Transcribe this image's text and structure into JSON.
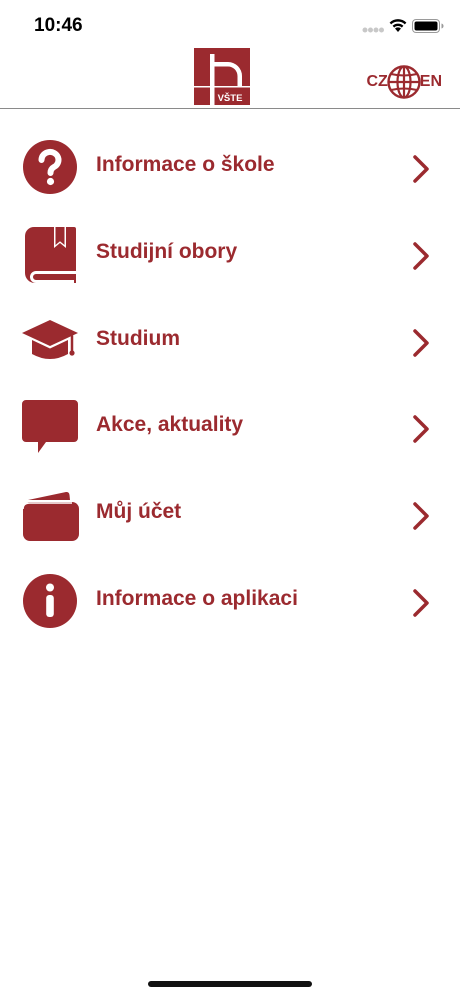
{
  "status_bar": {
    "time": "10:46"
  },
  "header": {
    "logo_text": "VŠTE",
    "lang_left": "CZ",
    "lang_right": "EN"
  },
  "colors": {
    "accent": "#9b2a2f",
    "divider": "#8a8a8a"
  },
  "menu": {
    "items": [
      {
        "label": "Informace o škole",
        "icon": "question-circle-icon"
      },
      {
        "label": "Studijní obory",
        "icon": "book-icon"
      },
      {
        "label": "Studium",
        "icon": "graduation-cap-icon"
      },
      {
        "label": "Akce, aktuality",
        "icon": "chat-bubble-icon"
      },
      {
        "label": "Můj účet",
        "icon": "wallet-icon"
      },
      {
        "label": "Informace o aplikaci",
        "icon": "info-circle-icon"
      }
    ]
  }
}
